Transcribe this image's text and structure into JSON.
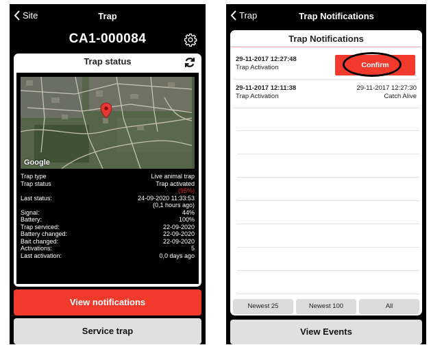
{
  "left": {
    "nav": {
      "back_label": "Site",
      "title": "Trap"
    },
    "trap_id": "CA1-000084",
    "card_title": "Trap status",
    "map_attribution": "Google",
    "info": {
      "trap_type_label": "Trap type",
      "trap_type_value": "Live animal trap",
      "trap_status_label": "Trap status",
      "trap_status_value": "Trap activated",
      "trap_status_extra": "(95%)",
      "last_status_label": "Last status:",
      "last_status_value": "24-09-2020 11:33:53",
      "last_status_ago": "(0,1 hours ago)",
      "signal_label": "Signal:",
      "signal_value": "44%",
      "battery_label": "Battery:",
      "battery_value": "100%",
      "serviced_label": "Trap serviced:",
      "serviced_value": "22-09-2020",
      "battery_changed_label": "Battery changed:",
      "battery_changed_value": "22-09-2020",
      "bait_changed_label": "Bait changed:",
      "bait_changed_value": "22-09-2020",
      "activations_label": "Activations:",
      "activations_value": "5",
      "last_activation_label": "Last activation:",
      "last_activation_value": "0,0 days ago"
    },
    "buttons": {
      "view_notifications": "View notifications",
      "service_trap": "Service trap"
    }
  },
  "right": {
    "nav": {
      "back_label": "Trap",
      "title": "Trap Notifications"
    },
    "card_title": "Trap Notifications",
    "notifications": [
      {
        "timestamp": "29-11-2017 12:27:48",
        "event": "Trap Activation",
        "action": "Confirm"
      },
      {
        "timestamp": "29-11-2017 12:11:38",
        "event": "Trap Activation",
        "confirmed_at": "29-11-2017 12:27:30",
        "status": "Catch Alive"
      }
    ],
    "filters": [
      "Newest 25",
      "Newest 100",
      "All"
    ],
    "view_events": "View Events"
  },
  "colors": {
    "accent_red": "#f23a2c",
    "background": "#000000",
    "card": "#ffffff",
    "button_grey": "#e0e0e0"
  },
  "icons": {
    "back": "chevron-left-icon",
    "settings": "gear-icon",
    "refresh": "refresh-icon",
    "map_marker": "map-pin-icon"
  }
}
